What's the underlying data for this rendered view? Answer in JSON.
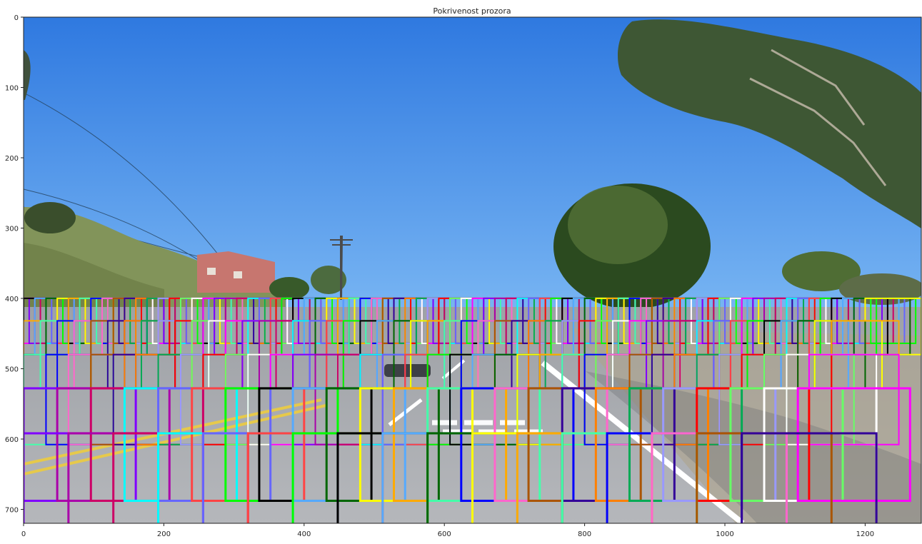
{
  "figure": {
    "title": "Pokrivenost prozora",
    "x_ticks": [
      "0",
      "200",
      "400",
      "600",
      "800",
      "1000",
      "1200"
    ],
    "y_ticks": [
      "0",
      "100",
      "200",
      "300",
      "400",
      "500",
      "600",
      "700"
    ],
    "xlim": [
      0,
      1280
    ],
    "ylim": [
      720,
      0
    ]
  },
  "scene": {
    "description_elements": [
      "sky",
      "trees",
      "road",
      "house",
      "utility-pole",
      "power-lines",
      "lane-markings",
      "shadows"
    ],
    "colors": {
      "sky_top": "#2f79e0",
      "sky_bottom": "#79b6f3",
      "road": "#a7a8ad",
      "tree_dark": "#2b4a1f",
      "tree_mid": "#4f6d34",
      "hill": "#82945a",
      "house": "#c7766f"
    }
  },
  "window_grid": {
    "rows": [
      {
        "y_top": 400,
        "size": 64,
        "x_start": 0,
        "x_step": 8,
        "count": 152
      },
      {
        "y_top": 400,
        "size": 80,
        "x_start": 0,
        "x_step": 16,
        "count": 76
      },
      {
        "y_top": 432,
        "size": 96,
        "x_start": 0,
        "x_step": 24,
        "count": 49
      },
      {
        "y_top": 480,
        "size": 128,
        "x_start": 0,
        "x_step": 32,
        "count": 36
      },
      {
        "y_top": 528,
        "size": 160,
        "x_start": 0,
        "x_step": 48,
        "count": 24
      },
      {
        "y_top": 592,
        "size": 192,
        "x_start": 0,
        "x_step": 64,
        "count": 17
      }
    ],
    "palette": [
      "#ff00ff",
      "#00ff00",
      "#0000ff",
      "#ff0000",
      "#00ffff",
      "#ffff00",
      "#ff8000",
      "#8000ff",
      "#000000",
      "#ff66cc",
      "#66ff66",
      "#6666ff",
      "#ffaa00",
      "#00aa55",
      "#aa00aa",
      "#55aaff",
      "#aa5500",
      "#ffffff",
      "#ff4444",
      "#44ffaa",
      "#9999ff",
      "#cc0066",
      "#006600",
      "#330099"
    ]
  }
}
